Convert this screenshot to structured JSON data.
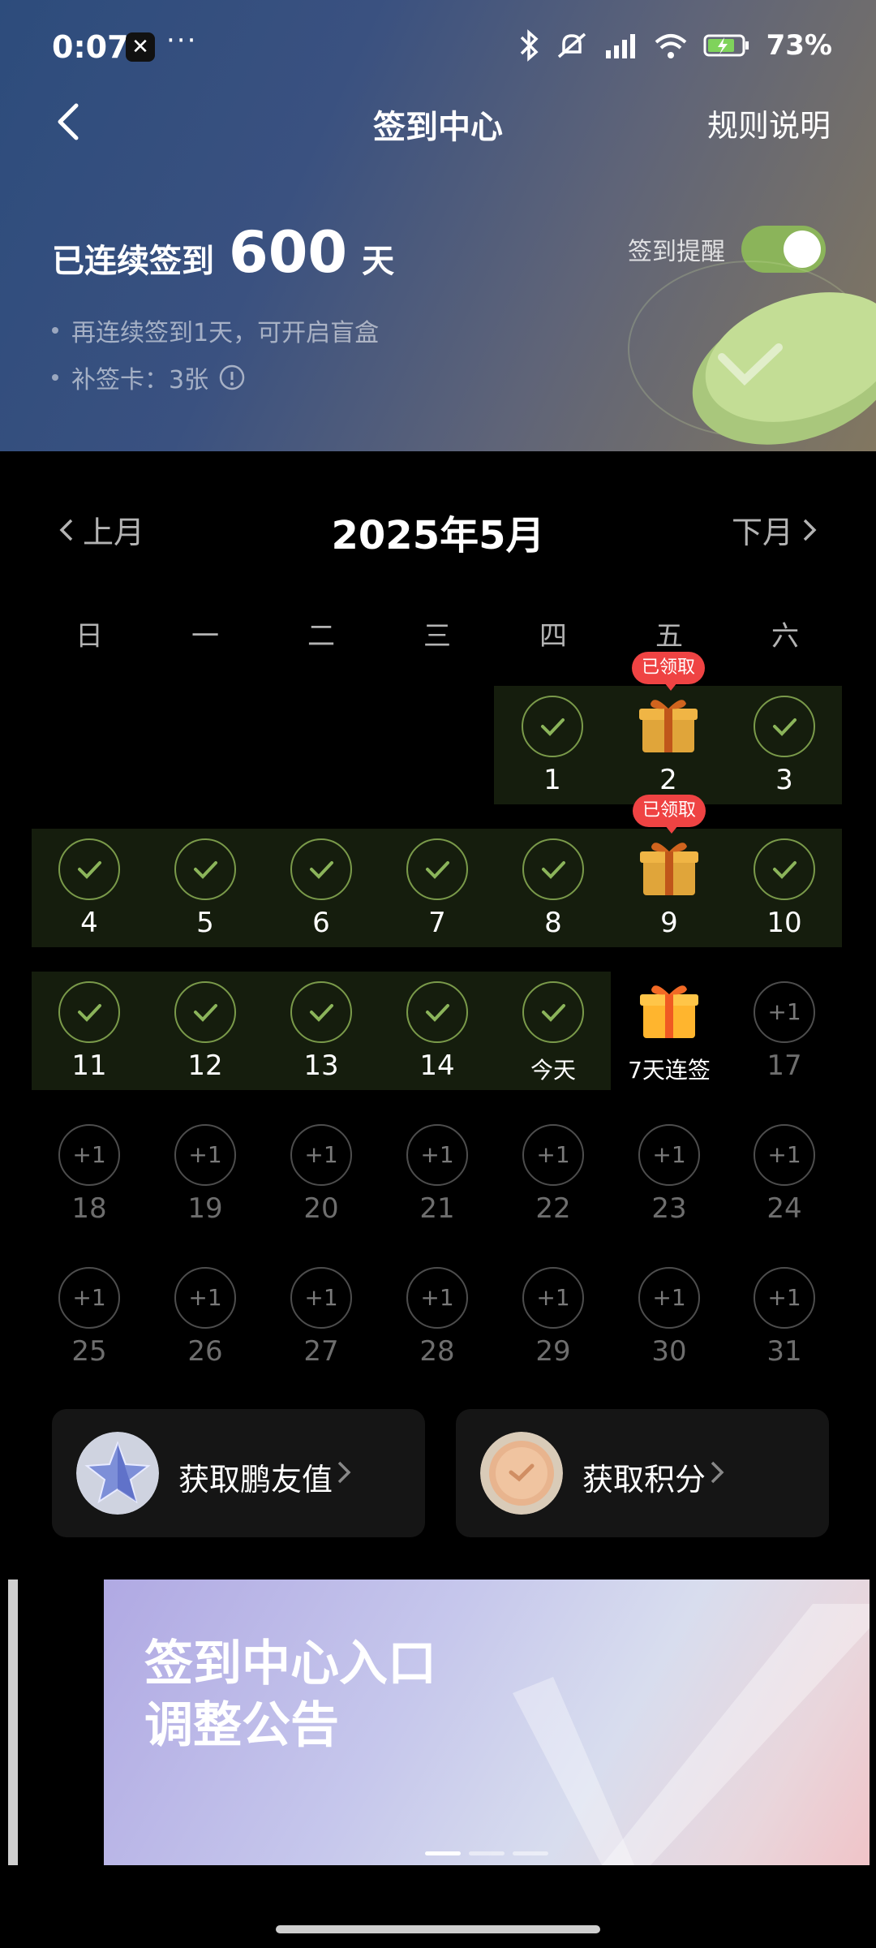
{
  "status_bar": {
    "time": "0:07",
    "battery": "73%"
  },
  "nav": {
    "title": "签到中心",
    "rules": "规则说明"
  },
  "streak": {
    "prefix": "已连续签到",
    "days": "600",
    "unit": "天"
  },
  "reminder": {
    "label": "签到提醒",
    "on": true
  },
  "hints": [
    "再连续签到1天，可开启盲盒",
    "补签卡：3张"
  ],
  "calendar": {
    "prev": "上月",
    "month": "2025年5月",
    "next": "下月",
    "weekdays": [
      "日",
      "一",
      "二",
      "三",
      "四",
      "五",
      "六"
    ],
    "claimed_badge": "已领取",
    "plus_label": "+1",
    "days": {
      "d1": "1",
      "d2": "2",
      "d3": "3",
      "d4": "4",
      "d5": "5",
      "d6": "6",
      "d7": "7",
      "d8": "8",
      "d9": "9",
      "d10": "10",
      "d11": "11",
      "d12": "12",
      "d13": "13",
      "d14": "14",
      "today": "今天",
      "d16": "7天连签",
      "d17": "17",
      "d18": "18",
      "d19": "19",
      "d20": "20",
      "d21": "21",
      "d22": "22",
      "d23": "23",
      "d24": "24",
      "d25": "25",
      "d26": "26",
      "d27": "27",
      "d28": "28",
      "d29": "29",
      "d30": "30",
      "d31": "31"
    }
  },
  "cards": {
    "friend_value": "获取鹏友值",
    "points": "获取积分"
  },
  "banner": {
    "line1": "签到中心入口",
    "line2": "调整公告"
  },
  "colors": {
    "accent_green": "#8bb45a",
    "badge_red": "#ef4343"
  }
}
